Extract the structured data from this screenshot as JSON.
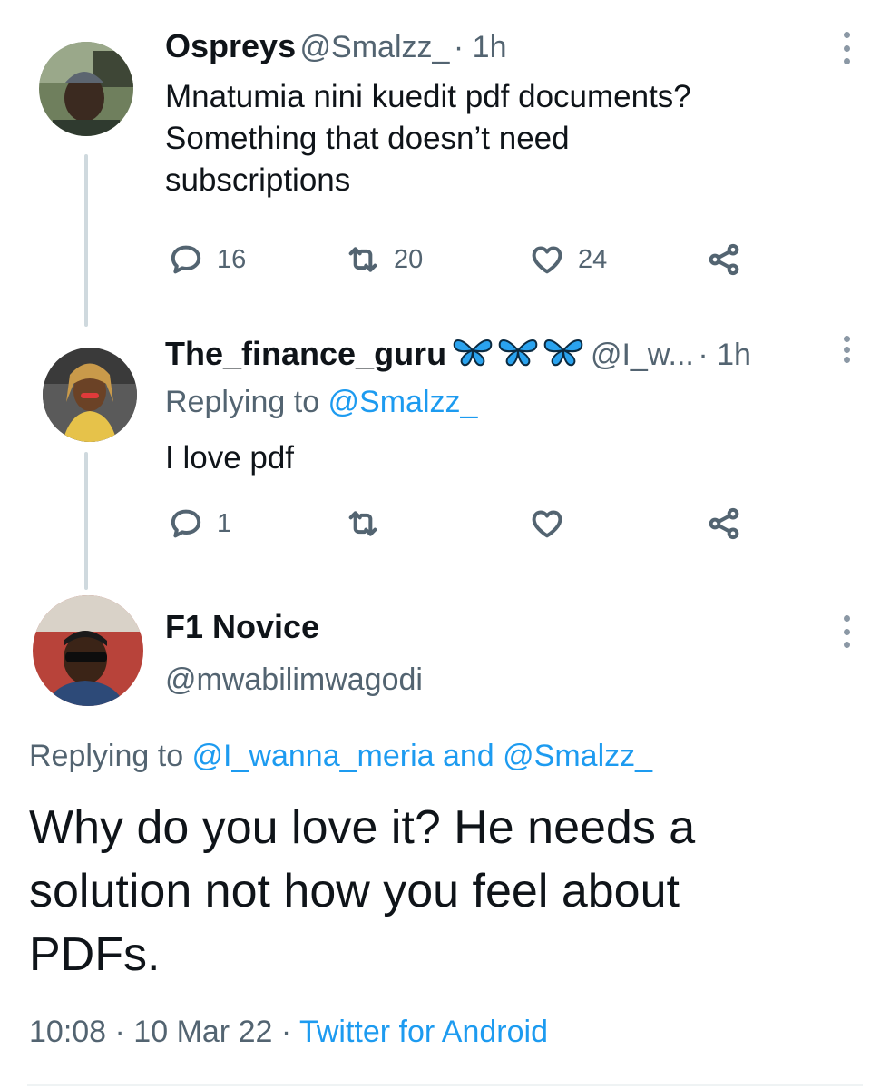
{
  "tweet1": {
    "display_name": "Ospreys",
    "handle": "@Smalzz_",
    "time": "· 1h",
    "text_lines": [
      "Mnatumia nini kuedit pdf documents?",
      "Something that doesn’t need",
      "subscriptions"
    ],
    "replies": "16",
    "retweets": "20",
    "likes": "24"
  },
  "tweet2": {
    "display_name": "The_finance_guru",
    "emoji": "🦋🦋🦋",
    "handle": "@I_w...",
    "time": "· 1h",
    "replying_prefix": "Replying to ",
    "replying_to": "@Smalzz_",
    "text": "I love pdf",
    "replies": "1"
  },
  "main_tweet": {
    "display_name": "F1 Novice",
    "handle": "@mwabilimwagodi",
    "replying_prefix": "Replying to ",
    "replying_to": "@I_wanna_meria and @Smalzz_",
    "text_lines": [
      "Why do you love it? He needs a",
      "solution not how you feel about",
      "PDFs."
    ],
    "timestamp": "10:08 · 10 Mar 22 · ",
    "source": "Twitter for Android"
  },
  "colors": {
    "link": "#1d9bf0",
    "muted": "#536471",
    "butterfly": "#2aa3ef"
  },
  "icons": [
    "reply-icon",
    "retweet-icon",
    "like-icon",
    "share-icon",
    "more-icon",
    "butterfly-emoji"
  ]
}
